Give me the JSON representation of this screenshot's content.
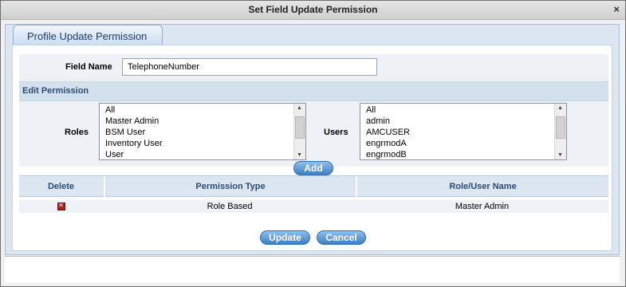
{
  "window": {
    "title": "Set Field Update Permission",
    "close_glyph": "×"
  },
  "tab": {
    "label": "Profile Update Permission"
  },
  "field": {
    "label": "Field Name",
    "value": "TelephoneNumber"
  },
  "edit_permission": {
    "header": "Edit Permission",
    "roles_label": "Roles",
    "users_label": "Users",
    "roles": [
      "All",
      "Master Admin",
      "BSM User",
      "Inventory User",
      "User"
    ],
    "users": [
      "All",
      "admin",
      "AMCUSER",
      "engrmodA",
      "engrmodB"
    ],
    "add_label": "Add"
  },
  "table": {
    "headers": {
      "delete": "Delete",
      "permission_type": "Permission Type",
      "role_user_name": "Role/User Name"
    },
    "rows": [
      {
        "permission_type": "Role Based",
        "role_user_name": "Master Admin"
      }
    ]
  },
  "actions": {
    "update_label": "Update",
    "cancel_label": "Cancel"
  },
  "icons": {
    "close": "close-icon",
    "delete": "delete-icon",
    "scroll_up": "scroll-up-icon",
    "scroll_down": "scroll-down-icon"
  },
  "colors": {
    "accent": "#3b7fc4",
    "header_bg": "#d3e1ee",
    "delete_icon": "#b21e1e"
  }
}
